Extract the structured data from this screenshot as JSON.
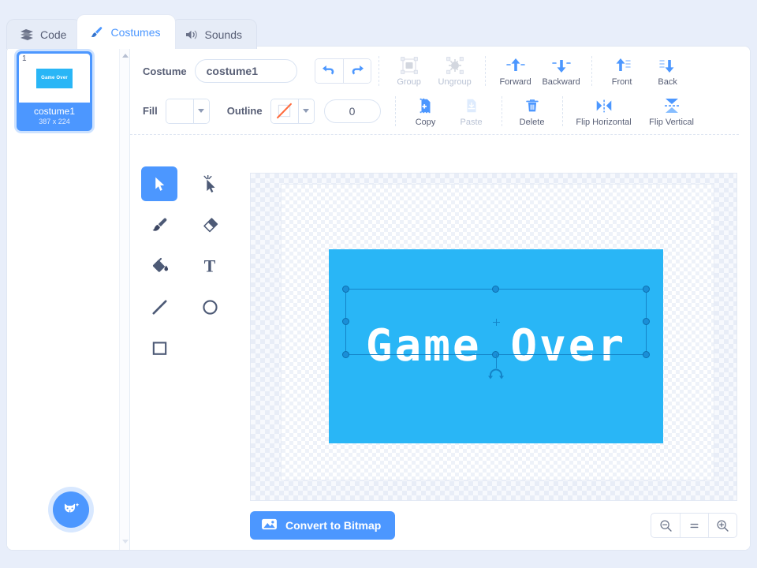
{
  "tabs": [
    {
      "label": "Code",
      "icon": "code-icon",
      "active": false
    },
    {
      "label": "Costumes",
      "icon": "brush-icon",
      "active": true
    },
    {
      "label": "Sounds",
      "icon": "speaker-icon",
      "active": false
    }
  ],
  "selector": {
    "costume": {
      "number": "1",
      "name": "costume1",
      "size": "387 x 224",
      "preview_text": "Game Over"
    },
    "add_button_label": "add-costume",
    "scroll_up": "scroll-up",
    "scroll_down": "scroll-down"
  },
  "toolbar": {
    "costume_label": "Costume",
    "costume_name": "costume1",
    "costume_name_placeholder": "costume1",
    "undo_label": "Undo",
    "redo_label": "Redo",
    "group_label": "Group",
    "ungroup_label": "Ungroup",
    "forward_label": "Forward",
    "backward_label": "Backward",
    "front_label": "Front",
    "back_label": "Back",
    "fill_label": "Fill",
    "outline_label": "Outline",
    "stroke_width": "0",
    "copy_label": "Copy",
    "paste_label": "Paste",
    "delete_label": "Delete",
    "flip_horizontal_label": "Flip Horizontal",
    "flip_vertical_label": "Flip Vertical"
  },
  "tools": [
    {
      "name": "select-tool",
      "label": "Select",
      "active": true
    },
    {
      "name": "reshape-tool",
      "label": "Reshape",
      "active": false
    },
    {
      "name": "brush-tool",
      "label": "Brush",
      "active": false
    },
    {
      "name": "eraser-tool",
      "label": "Eraser",
      "active": false
    },
    {
      "name": "fill-tool",
      "label": "Fill",
      "active": false
    },
    {
      "name": "text-tool",
      "label": "Text",
      "active": false
    },
    {
      "name": "line-tool",
      "label": "Line",
      "active": false
    },
    {
      "name": "ellipse-tool",
      "label": "Circle",
      "active": false
    },
    {
      "name": "rectangle-tool",
      "label": "Rectangle",
      "active": false
    }
  ],
  "canvas": {
    "artwork_text": "Game Over",
    "rect_color": "#29b6f6",
    "text_color": "#ffffff",
    "selection_active": true
  },
  "bottom": {
    "convert_label": "Convert to Bitmap",
    "zoom_out_label": "Zoom out",
    "zoom_reset_label": "=",
    "zoom_in_label": "Zoom in"
  },
  "colors": {
    "accent": "#4c97ff",
    "text": "#575e75",
    "background": "#e8eefa",
    "artwork_blue": "#29b6f6"
  }
}
